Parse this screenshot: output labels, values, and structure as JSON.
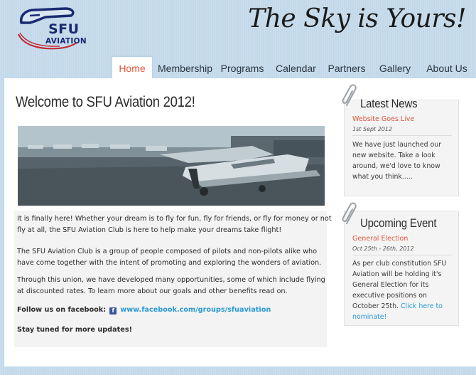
{
  "header": {
    "logo_line1": "SFU",
    "logo_line2": "AVIATION",
    "tagline": "The Sky is Yours!"
  },
  "nav": {
    "items": [
      {
        "label": "Home",
        "active": true
      },
      {
        "label": "Membership"
      },
      {
        "label": "Programs"
      },
      {
        "label": "Calendar"
      },
      {
        "label": "Partners"
      },
      {
        "label": "Gallery"
      },
      {
        "label": "About Us"
      }
    ]
  },
  "main": {
    "title": "Welcome to SFU Aviation 2012!",
    "paragraphs": [
      "It is finally here! Whether your dream is to fly for fun, fly for friends, or fly for money or not fly at all, the SFU Aviation Club is here to help make your dreams take flight!",
      "The SFU Aviation Club is a group of people composed of pilots and non-pilots alike who have come together with the intent of promoting and exploring the wonders of aviation.",
      "Through this union, we have developed many opportunities, some of which include flying at discounted rates. To learn more about our goals and other benefits read on."
    ],
    "follow_label": "Follow us on facebook:",
    "facebook_link": "www.facebook.com/groups/sfuaviation",
    "closing": "Stay tuned for more updates!"
  },
  "sidebar": {
    "news": {
      "title": "Latest News",
      "headline": "Website Goes Live",
      "date": "1st Sept 2012",
      "text": "We have just launched our new website. Take a look around, we'd love to know what you think....."
    },
    "event": {
      "title": "Upcoming Event",
      "headline": "General Election",
      "date": "Oct 25th - 26th, 2012",
      "text": "As per club constitution SFU Aviation will be holding it's General Election for its executive positions on October 25th.",
      "link": "Click here to nominate!"
    }
  },
  "colors": {
    "accent": "#e0563a",
    "link": "#2a9ad6",
    "background": "#c3d9ea",
    "logo": "#1a2a72"
  }
}
